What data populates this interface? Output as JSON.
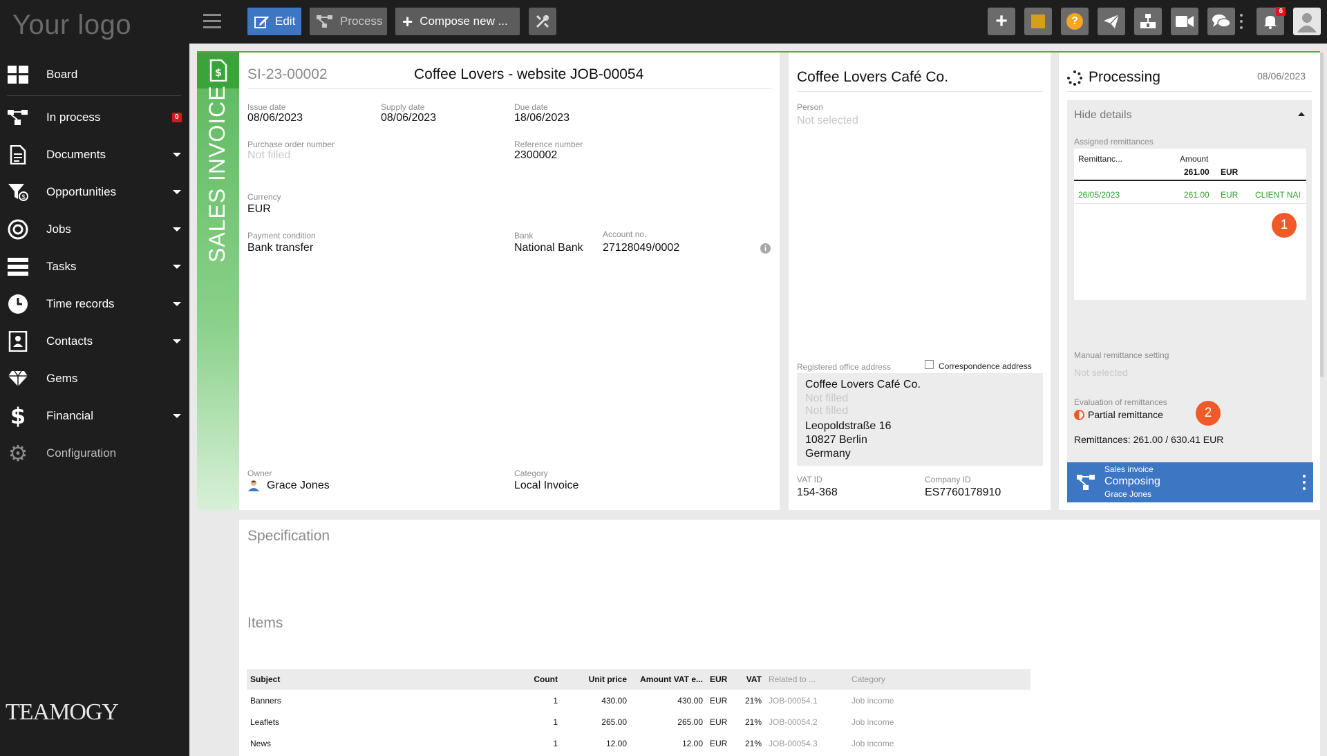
{
  "sidebar": {
    "logo": "Your logo",
    "items": [
      {
        "label": "Board"
      },
      {
        "label": "In process",
        "badge": "0"
      },
      {
        "label": "Documents"
      },
      {
        "label": "Opportunities"
      },
      {
        "label": "Jobs"
      },
      {
        "label": "Tasks"
      },
      {
        "label": "Time records"
      },
      {
        "label": "Contacts"
      },
      {
        "label": "Gems"
      },
      {
        "label": "Financial"
      },
      {
        "label": "Configuration"
      }
    ],
    "brand": "TEAMOGY"
  },
  "toolbar": {
    "edit": "Edit",
    "process": "Process",
    "compose": "Compose new ...",
    "notif_count": "6"
  },
  "invoice": {
    "number": "SI-23-00002",
    "title": "Coffee Lovers - website JOB-00054",
    "type_label": "SALES INVOICE",
    "issue_date_label": "Issue date",
    "issue_date": "08/06/2023",
    "supply_date_label": "Supply date",
    "supply_date": "08/06/2023",
    "due_date_label": "Due date",
    "due_date": "18/06/2023",
    "po_label": "Purchase order number",
    "po_value": "Not filled",
    "ref_label": "Reference number",
    "ref_value": "2300002",
    "currency_label": "Currency",
    "currency": "EUR",
    "payment_label": "Payment condition",
    "payment": "Bank transfer",
    "bank_label": "Bank",
    "bank": "National Bank",
    "account_label": "Account no.",
    "account": "27128049/0002",
    "owner_label": "Owner",
    "owner": "Grace Jones",
    "category_label": "Category",
    "category": "Local Invoice"
  },
  "client": {
    "name": "Coffee Lovers Café Co.",
    "person_label": "Person",
    "person": "Not selected",
    "office_label": "Registered office address",
    "corr_label": "Correspondence address",
    "addr_name": "Coffee Lovers Café Co.",
    "addr_nf1": "Not filled",
    "addr_nf2": "Not filled",
    "street": "Leopoldstraße 16",
    "city": "10827 Berlin",
    "country": "Germany",
    "vat_label": "VAT ID",
    "vat": "154-368",
    "company_label": "Company ID",
    "company": "ES7760178910"
  },
  "processing": {
    "title": "Processing",
    "date": "08/06/2023",
    "hide_details": "Hide details",
    "assigned_label": "Assigned remittances",
    "col_remit": "Remittanc...",
    "col_amount": "Amount",
    "total_amount": "261.00",
    "total_cur": "EUR",
    "row_date": "26/05/2023",
    "row_amount": "261.00",
    "row_cur": "EUR",
    "row_client": "CLIENT NAI",
    "marker1": "1",
    "manual_label": "Manual remittance setting",
    "manual_value": "Not selected",
    "eval_label": "Evaluation of remittances",
    "eval_value": "Partial remittance",
    "marker2": "2",
    "remit_summary": "Remittances: 261.00 / 630.41 EUR",
    "card_kind": "Sales invoice",
    "card_state": "Composing",
    "card_owner": "Grace Jones"
  },
  "spec": {
    "spec_title": "Specification",
    "items_title": "Items",
    "headers": [
      "Subject",
      "Count",
      "Unit price",
      "Amount VAT e...",
      "EUR",
      "VAT",
      "Related to ...",
      "Category"
    ],
    "rows": [
      [
        "Banners",
        "1",
        "430.00",
        "430.00",
        "EUR",
        "21%",
        "JOB-00054.1",
        "Job income"
      ],
      [
        "Leaflets",
        "1",
        "265.00",
        "265.00",
        "EUR",
        "21%",
        "JOB-00054.2",
        "Job income"
      ],
      [
        "News",
        "1",
        "12.00",
        "12.00",
        "EUR",
        "21%",
        "JOB-00054.3",
        "Job income"
      ]
    ]
  },
  "colors": {
    "accent_blue": "#3d77c4",
    "green": "#4cae4c",
    "badge_red": "#e0151c",
    "marker_orange": "#f05a28"
  }
}
